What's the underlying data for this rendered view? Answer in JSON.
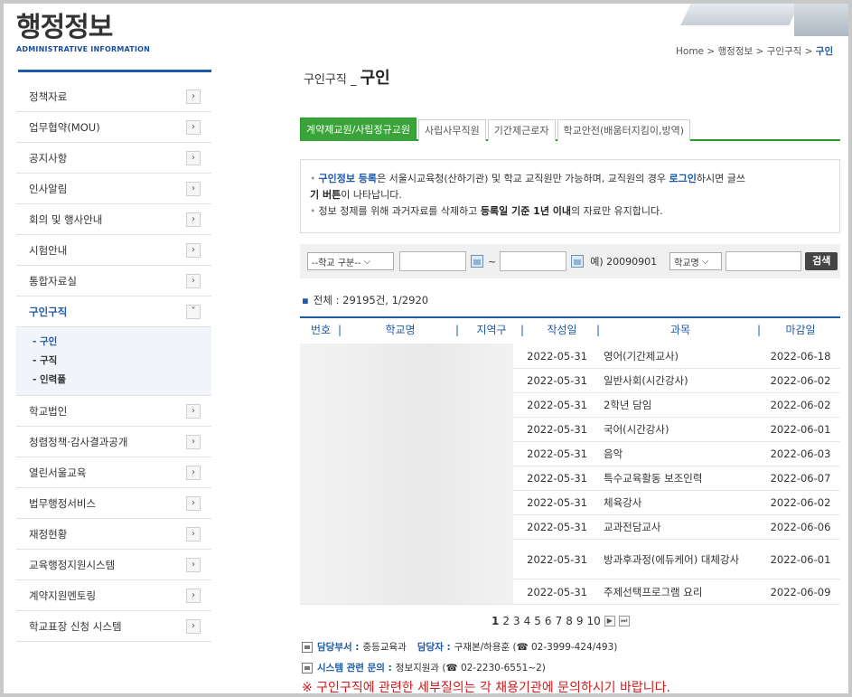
{
  "brand": {
    "title": "행정정보",
    "subtitle": "ADMINISTRATIVE INFORMATION"
  },
  "breadcrumb": {
    "home": "Home",
    "sep": ">",
    "level1": "행정정보",
    "level2": "구인구직",
    "current": "구인"
  },
  "page_title": {
    "prefix": "구인구직 _",
    "main": "구인"
  },
  "nav": {
    "items": [
      {
        "label": "정책자료"
      },
      {
        "label": "업무협약(MOU)"
      },
      {
        "label": "공지사항"
      },
      {
        "label": "인사알림"
      },
      {
        "label": "회의 및 행사안내"
      },
      {
        "label": "시험안내"
      },
      {
        "label": "통합자료실"
      },
      {
        "label": "구인구직"
      },
      {
        "label": "학교법인"
      },
      {
        "label": "청렴정책·감사결과공개"
      },
      {
        "label": "열린서울교육"
      },
      {
        "label": "법무행정서비스"
      },
      {
        "label": "재정현황"
      },
      {
        "label": "교육행정지원시스템"
      },
      {
        "label": "계약지원멘토링"
      },
      {
        "label": "학교표장 신청 시스템"
      }
    ],
    "sub_items": [
      "- 구인",
      "- 구직",
      "- 인력풀"
    ],
    "chev_closed": "›",
    "chev_open": "˅"
  },
  "tabs": [
    {
      "label": "계약제교원/사립정규교원"
    },
    {
      "label": "사립사무직원"
    },
    {
      "label": "기간제근로자"
    },
    {
      "label": "학교안전(배움터지킴이,방역)"
    }
  ],
  "notice": {
    "l1_a": "구인정보 등록",
    "l1_b": "은 서울시교육청(산하기관) 및 학교 교직원만 가능하며, 교직원의 경우 ",
    "l1_c": "로그인",
    "l1_d": "하시면 글쓰",
    "l1_e": "기 버튼",
    "l1_f": "이 나타납니다.",
    "l2_a": "정보 정제를 위해 과거자료를 삭제하고 ",
    "l2_b": "등록일 기준 1년 이내",
    "l2_c": "의 자료만 유지합니다."
  },
  "search": {
    "school_type": "--학교 구분--",
    "date_from": "",
    "tilde": "~",
    "date_to": "",
    "example": "예) 20090901",
    "field": "학교명",
    "keyword": "",
    "button": "검색"
  },
  "total": "전체 : 29195건, 1/2920",
  "table": {
    "headers": [
      "번호",
      "학교명",
      "지역구",
      "작성일",
      "과목",
      "마감일"
    ],
    "rows": [
      {
        "date": "2022-05-31",
        "subject": "영어(기간제교사)",
        "due": "2022-06-18"
      },
      {
        "date": "2022-05-31",
        "subject": "일반사회(시간강사)",
        "due": "2022-06-02"
      },
      {
        "date": "2022-05-31",
        "subject": "2학년 담임",
        "due": "2022-06-02"
      },
      {
        "date": "2022-05-31",
        "subject": "국어(시간강사)",
        "due": "2022-06-01"
      },
      {
        "date": "2022-05-31",
        "subject": "음악",
        "due": "2022-06-03"
      },
      {
        "date": "2022-05-31",
        "subject": "특수교육활동 보조인력",
        "due": "2022-06-07"
      },
      {
        "date": "2022-05-31",
        "subject": "체육강사",
        "due": "2022-06-02"
      },
      {
        "date": "2022-05-31",
        "subject": "교과전담교사",
        "due": "2022-06-06"
      },
      {
        "date": "2022-05-31",
        "subject": "방과후과정(에듀케어) 대체강사",
        "due": "2022-06-01"
      },
      {
        "date": "2022-05-31",
        "subject": "주제선택프로그램 요리",
        "due": "2022-06-09"
      }
    ]
  },
  "paging": {
    "pages": [
      "1",
      "2",
      "3",
      "4",
      "5",
      "6",
      "7",
      "8",
      "9",
      "10"
    ],
    "next": "▶",
    "last": "⏭"
  },
  "contact": {
    "dept_label": "담당부서 :",
    "dept": "중등교육과",
    "person_label": "담당자 :",
    "person": "구재본/하용훈 (☎ 02-3999-424/493)",
    "sys_label": "시스템 관련 문의 :",
    "sys": "정보지원과 (☎ 02-2230-6551~2)"
  },
  "warning": "※ 구인구직에 관련한 세부질의는 각 채용기관에 문의하시기 바랍니다."
}
